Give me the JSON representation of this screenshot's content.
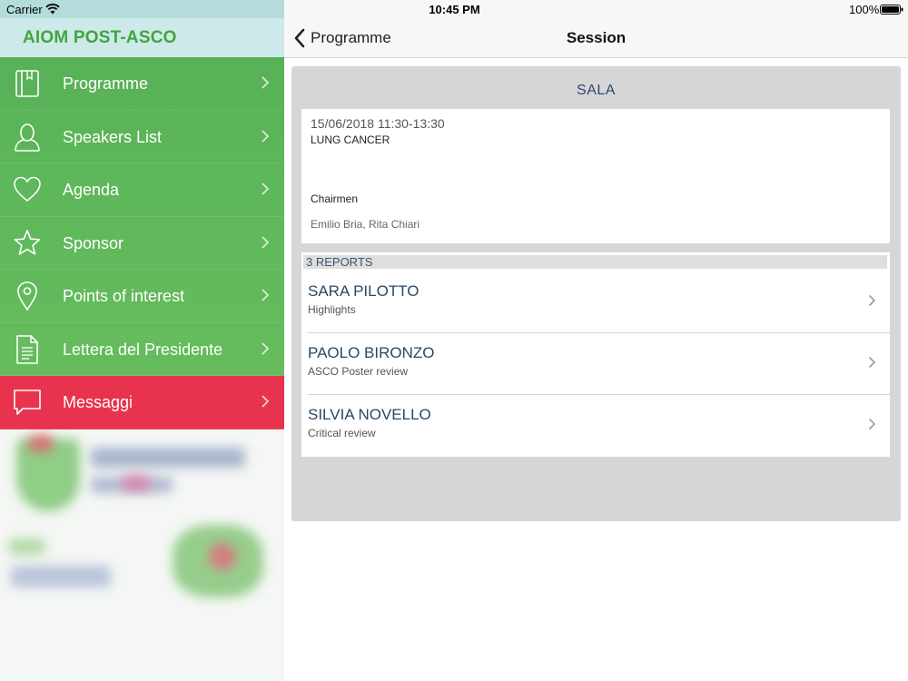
{
  "status_bar": {
    "carrier": "Carrier",
    "time": "10:45 PM",
    "battery": "100%"
  },
  "sidebar": {
    "app_title": "AIOM POST-ASCO",
    "items": [
      {
        "label": "Programme",
        "icon": "book-icon"
      },
      {
        "label": "Speakers List",
        "icon": "person-icon"
      },
      {
        "label": "Agenda",
        "icon": "heart-icon"
      },
      {
        "label": "Sponsor",
        "icon": "star-icon"
      },
      {
        "label": "Points of interest",
        "icon": "location-pin-icon"
      },
      {
        "label": "Lettera del Presidente",
        "icon": "document-icon"
      },
      {
        "label": "Messaggi",
        "icon": "chat-bubble-icon",
        "active": true
      }
    ]
  },
  "navbar": {
    "back_label": "Programme",
    "title": "Session"
  },
  "session": {
    "room": "SALA",
    "datetime": "15/06/2018 11:30-13:30",
    "topic": "LUNG CANCER",
    "chairmen_label": "Chairmen",
    "chairmen": "Emilio Bria, Rita Chiari"
  },
  "reports": {
    "header": "3 REPORTS",
    "items": [
      {
        "speaker": "SARA PILOTTO",
        "title": "Highlights"
      },
      {
        "speaker": "PAOLO BIRONZO",
        "title": "ASCO Poster review"
      },
      {
        "speaker": "SILVIA NOVELLO",
        "title": "Critical review"
      }
    ]
  },
  "colors": {
    "menu_green": "#5fb85b",
    "active_red": "#e8334f",
    "header_teal": "#cde9e9",
    "brand_green": "#3fa63c",
    "panel_gray": "#d6d6d9",
    "accent_navy": "#2c4766"
  }
}
